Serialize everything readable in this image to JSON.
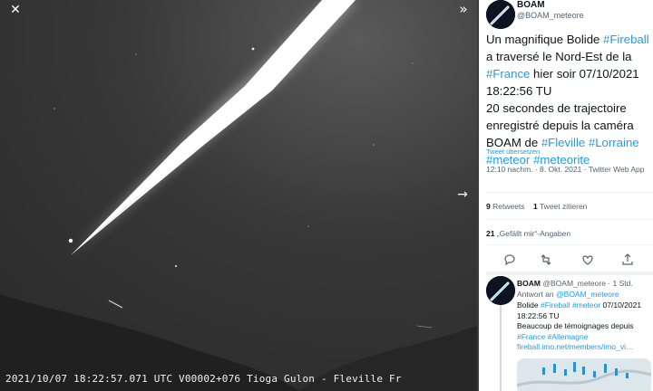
{
  "viewer": {
    "close_icon": "close-icon",
    "collapse_icon": "double-chevron-right-icon",
    "next_icon": "arrow-right-icon",
    "caption": "2021/10/07 18:22:57.071 UTC V00002+076 Tioga Gulon - Fleville Fr"
  },
  "tweet": {
    "name": "BOAM",
    "handle": "@BOAM_meteore",
    "text_parts": [
      {
        "t": "Un magnifique Bolide ",
        "tag": false
      },
      {
        "t": "#Fireball",
        "tag": true
      },
      {
        "t": " a traversé le Nord-Est de la ",
        "tag": false
      },
      {
        "t": "#France",
        "tag": true
      },
      {
        "t": " hier soir 07/10/2021 18:22:56 TU\n20 secondes de trajectoire enregistré depuis la caméra BOAM de ",
        "tag": false
      },
      {
        "t": "#Fleville",
        "tag": true
      },
      {
        "t": " ",
        "tag": false
      },
      {
        "t": "#Lorraine",
        "tag": true
      },
      {
        "t": " ",
        "tag": false
      },
      {
        "t": "#meteor",
        "tag": true
      },
      {
        "t": " ",
        "tag": false
      },
      {
        "t": "#meteorite",
        "tag": true
      }
    ],
    "translate": "Tweet übersetzen",
    "meta": "12:10 nachm. · 8. Okt. 2021 · Twitter Web App",
    "retweets_count": "9",
    "retweets_label": "Retweets",
    "quotes_count": "1",
    "quotes_label": "Tweet zitieren",
    "likes_count": "21",
    "likes_label": "„Gefällt mir“-Angaben",
    "actions": [
      "reply-icon",
      "retweet-icon",
      "like-icon",
      "share-icon"
    ]
  },
  "reply": {
    "name": "BOAM",
    "handle_time": "@BOAM_meteore · 1 Std.",
    "reply_prefix": "Antwort an",
    "reply_to": "@BOAM_meteore",
    "line1_parts": [
      {
        "t": "Bolide ",
        "tag": false
      },
      {
        "t": "#Fireball",
        "tag": true
      },
      {
        "t": " ",
        "tag": false
      },
      {
        "t": "#meteor",
        "tag": true
      },
      {
        "t": " 07/10/2021 18:22:56 TU",
        "tag": false
      }
    ],
    "line2": "Beaucoup de témoignages depuis",
    "line3_parts": [
      {
        "t": "#France",
        "tag": true
      },
      {
        "t": " ",
        "tag": false
      },
      {
        "t": "#Allemagne",
        "tag": true
      }
    ],
    "link": "fireball.imo.net/members/imo_vi…"
  }
}
